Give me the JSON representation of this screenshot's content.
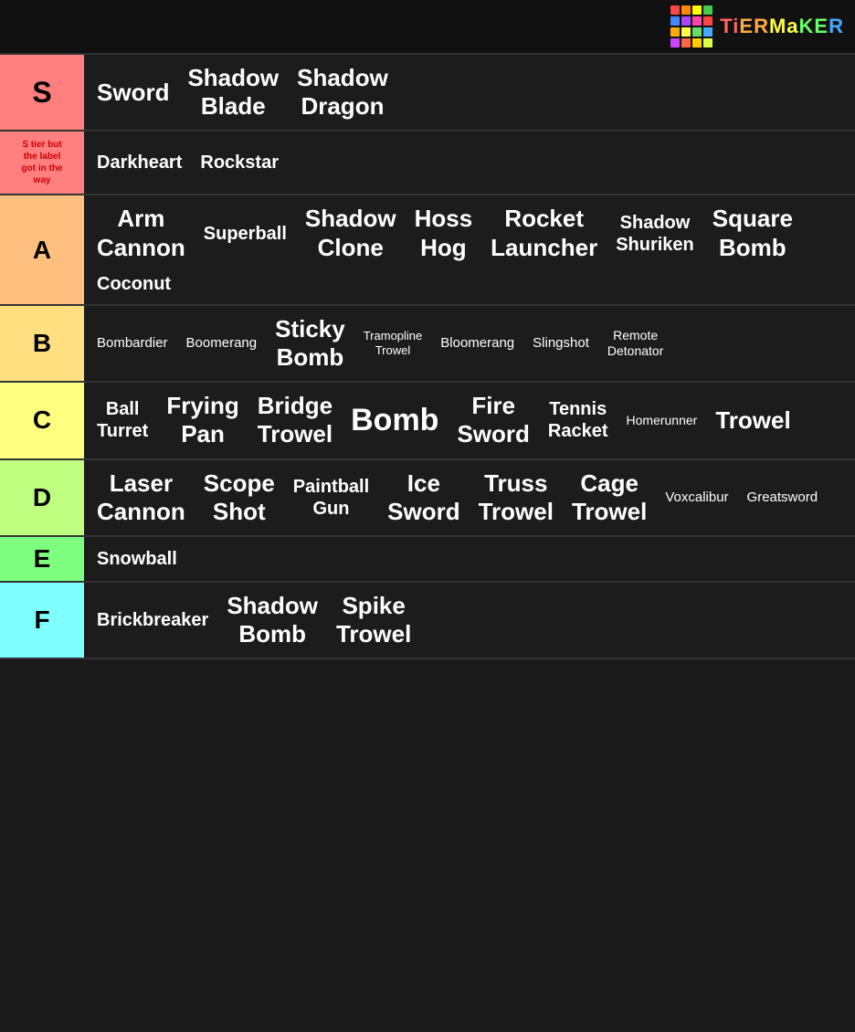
{
  "header": {
    "logo_text": "TiERMaKER"
  },
  "tiers": [
    {
      "id": "s",
      "label": "S",
      "color": "#ff7f7f",
      "label_style": "normal",
      "items": [
        {
          "text": "Sword",
          "size": "large"
        },
        {
          "text": "Shadow Blade",
          "size": "large"
        },
        {
          "text": "Shadow Dragon",
          "size": "large"
        }
      ]
    },
    {
      "id": "s2",
      "label": "S tier but the label got in the way",
      "color": "#ff7f7f",
      "label_style": "small-red",
      "items": [
        {
          "text": "Darkheart",
          "size": "medium"
        },
        {
          "text": "Rockstar",
          "size": "medium"
        }
      ]
    },
    {
      "id": "a",
      "label": "A",
      "color": "#ffbf7f",
      "label_style": "normal",
      "items": [
        {
          "text": "Arm Cannon",
          "size": "large"
        },
        {
          "text": "Superball",
          "size": "medium"
        },
        {
          "text": "Shadow Clone",
          "size": "large"
        },
        {
          "text": "Hoss Hog",
          "size": "large"
        },
        {
          "text": "Rocket Launcher",
          "size": "large"
        },
        {
          "text": "Shadow Shuriken",
          "size": "medium"
        },
        {
          "text": "Square Bomb",
          "size": "large"
        },
        {
          "text": "Coconut",
          "size": "medium"
        }
      ]
    },
    {
      "id": "b",
      "label": "B",
      "color": "#ffdf80",
      "label_style": "normal",
      "items": [
        {
          "text": "Bombardier",
          "size": "small"
        },
        {
          "text": "Boomerang",
          "size": "small"
        },
        {
          "text": "Sticky Bomb",
          "size": "large"
        },
        {
          "text": "Tramopline Trowel",
          "size": "small"
        },
        {
          "text": "Bloomerang",
          "size": "small"
        },
        {
          "text": "Slingshot",
          "size": "small"
        },
        {
          "text": "Remote Detonator",
          "size": "small"
        }
      ]
    },
    {
      "id": "c",
      "label": "C",
      "color": "#ffff7f",
      "label_style": "normal",
      "items": [
        {
          "text": "Ball Turret",
          "size": "medium"
        },
        {
          "text": "Frying Pan",
          "size": "large"
        },
        {
          "text": "Bridge Trowel",
          "size": "large"
        },
        {
          "text": "Bomb",
          "size": "xlarge"
        },
        {
          "text": "Fire Sword",
          "size": "large"
        },
        {
          "text": "Tennis Racket",
          "size": "medium"
        },
        {
          "text": "Homerunner",
          "size": "small"
        },
        {
          "text": "Trowel",
          "size": "large"
        }
      ]
    },
    {
      "id": "d",
      "label": "D",
      "color": "#bfff7f",
      "label_style": "normal",
      "items": [
        {
          "text": "Laser Cannon",
          "size": "large"
        },
        {
          "text": "Scope Shot",
          "size": "large"
        },
        {
          "text": "Paintball Gun",
          "size": "medium"
        },
        {
          "text": "Ice Sword",
          "size": "large"
        },
        {
          "text": "Truss Trowel",
          "size": "large"
        },
        {
          "text": "Cage Trowel",
          "size": "large"
        },
        {
          "text": "Voxcalibur",
          "size": "small"
        },
        {
          "text": "Greatsword",
          "size": "small"
        }
      ]
    },
    {
      "id": "e",
      "label": "E",
      "color": "#7fff7f",
      "label_style": "normal",
      "items": [
        {
          "text": "Snowball",
          "size": "medium"
        }
      ]
    },
    {
      "id": "f",
      "label": "F",
      "color": "#7fffff",
      "label_style": "normal",
      "items": [
        {
          "text": "Brickbreaker",
          "size": "medium"
        },
        {
          "text": "Shadow Bomb",
          "size": "large"
        },
        {
          "text": "Spike Trowel",
          "size": "large"
        }
      ]
    }
  ],
  "logo": {
    "colors": [
      "#ff4444",
      "#ff8800",
      "#ffff00",
      "#44cc44",
      "#4488ff",
      "#aa44ff",
      "#ff44aa",
      "#ff4444",
      "#ffaa00",
      "#ffff44",
      "#66dd66",
      "#44aaff",
      "#cc44ff",
      "#ff6644",
      "#ffcc00",
      "#ddff44"
    ]
  }
}
